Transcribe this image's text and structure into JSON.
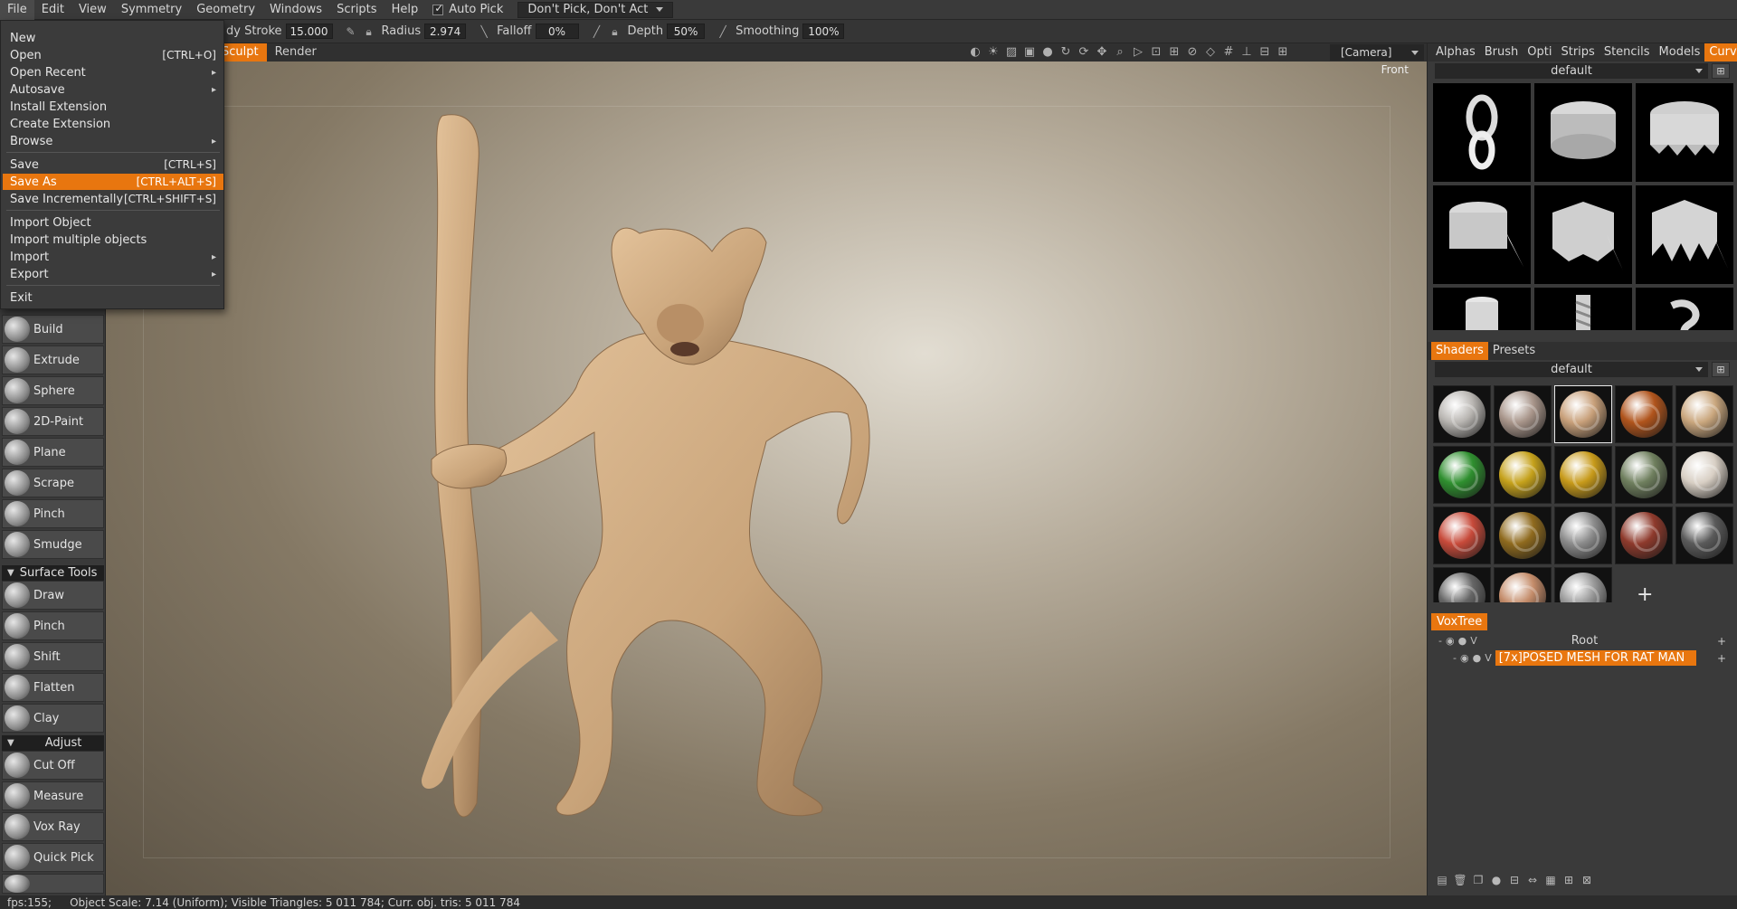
{
  "menubar": {
    "items": [
      "File",
      "Edit",
      "View",
      "Symmetry",
      "Geometry",
      "Windows",
      "Scripts",
      "Help"
    ],
    "auto_pick_label": "Auto Pick",
    "pick_mode_value": "Don't Pick, Don't Act"
  },
  "toolbar": {
    "stroke_label": "dy Stroke",
    "stroke_value": "15.000",
    "radius_label": "Radius",
    "radius_value": "2.974",
    "falloff_label": "Falloff",
    "falloff_value": "0%",
    "depth_label": "Depth",
    "depth_value": "50%",
    "smoothing_label": "Smoothing",
    "smoothing_value": "100%"
  },
  "rooms": {
    "tabs": [
      "Sculpt",
      "Render"
    ],
    "active": "Sculpt",
    "camera_value": "[Camera]"
  },
  "viewport": {
    "view_name": "Front"
  },
  "file_menu": {
    "items": [
      {
        "label": "New",
        "shortcut": "",
        "submenu": false
      },
      {
        "label": "Open",
        "shortcut": "[CTRL+O]",
        "submenu": false
      },
      {
        "label": "Open Recent",
        "shortcut": "",
        "submenu": true
      },
      {
        "label": "Autosave",
        "shortcut": "",
        "submenu": true
      },
      {
        "label": "Install Extension",
        "shortcut": "",
        "submenu": false
      },
      {
        "label": "Create Extension",
        "shortcut": "",
        "submenu": false
      },
      {
        "label": "Browse",
        "shortcut": "",
        "submenu": true
      },
      {
        "label": "Save",
        "shortcut": "[CTRL+S]",
        "submenu": false
      },
      {
        "label": "Save As",
        "shortcut": "[CTRL+ALT+S]",
        "submenu": false,
        "highlighted": true
      },
      {
        "label": "Save Incrementally",
        "shortcut": "[CTRL+SHIFT+S]",
        "submenu": false
      },
      {
        "label": "Import Object",
        "shortcut": "",
        "submenu": false
      },
      {
        "label": "Import multiple objects",
        "shortcut": "",
        "submenu": false
      },
      {
        "label": "Import",
        "shortcut": "",
        "submenu": true
      },
      {
        "label": "Export",
        "shortcut": "",
        "submenu": true
      },
      {
        "label": "Exit",
        "shortcut": "",
        "submenu": false
      }
    ]
  },
  "tools": {
    "group1": [
      "Build",
      "Extrude",
      "Sphere",
      "2D-Paint",
      "Plane",
      "Scrape",
      "Pinch",
      "Smudge"
    ],
    "surface_header": "Surface Tools",
    "group2": [
      "Draw",
      "Pinch",
      "Shift",
      "Flatten",
      "Clay"
    ],
    "adjust_header": "Adjust",
    "group3": [
      "Cut Off",
      "Measure",
      "Vox Ray",
      "Quick Pick"
    ]
  },
  "right_panel": {
    "tabs": [
      "Alphas",
      "Brush",
      "Opti",
      "Strips",
      "Stencils",
      "Models",
      "Curves"
    ],
    "active_tab": "Curves",
    "curves_preset": "default",
    "shader_tabs": [
      "Shaders",
      "Presets"
    ],
    "shader_active": "Shaders",
    "shader_preset": "default",
    "shader_colors": [
      "#b9b6b2",
      "#a8958a",
      "#c8a07a",
      "#b0541c",
      "#caa77e",
      "#2f8f2f",
      "#c5a11b",
      "#c79a1a",
      "#6f7f5e",
      "#d8cfc4",
      "#c74a3a",
      "#8f6a1e",
      "#8c8c8c",
      "#8e3a2c",
      "#5a5a5a",
      "#666666",
      "#c48c6a",
      "#9a9a9a"
    ],
    "voxtree_label": "VoxTree",
    "voxtree_root": "Root",
    "voxtree_object": "[7x]POSED MESH FOR RAT MAN"
  },
  "status": {
    "fps": "fps:155;",
    "info": "Object Scale: 7.14 (Uniform); Visible Triangles: 5 011 784; Curr. obj. tris: 5 011 784"
  }
}
